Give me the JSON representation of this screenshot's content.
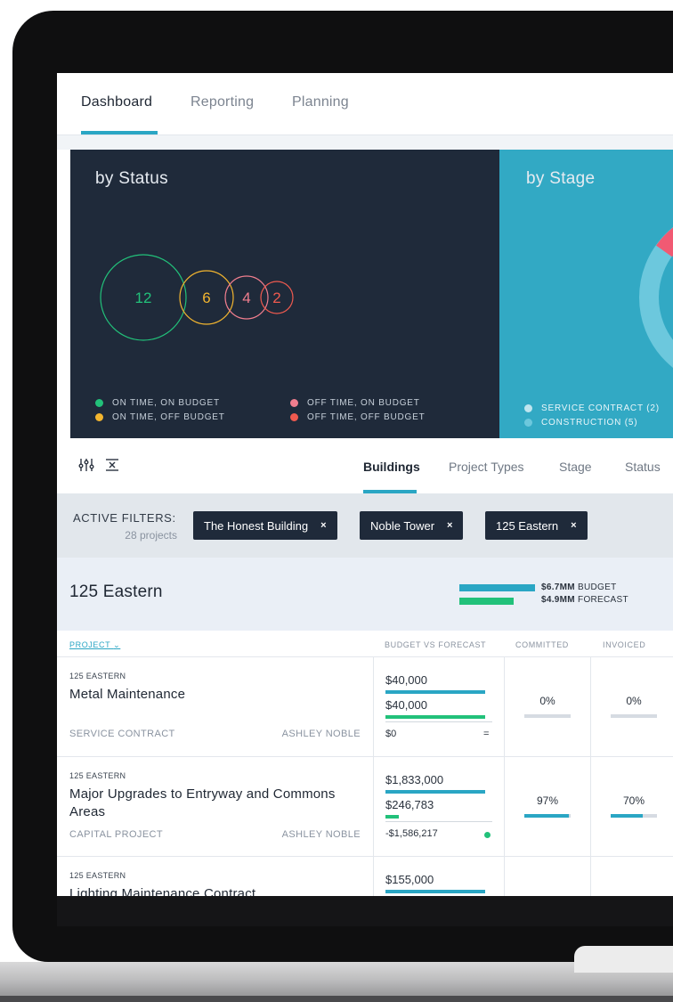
{
  "nav": {
    "tabs": [
      {
        "label": "Dashboard",
        "active": true
      },
      {
        "label": "Reporting",
        "active": false
      },
      {
        "label": "Planning",
        "active": false
      }
    ]
  },
  "charts": {
    "status": {
      "title": "by Status",
      "bubbles": [
        {
          "value": "12",
          "color": "#22c17a"
        },
        {
          "value": "6",
          "color": "#f2b52f"
        },
        {
          "value": "4",
          "color": "#f07e8e"
        },
        {
          "value": "2",
          "color": "#ef5a4f"
        }
      ],
      "legend": [
        {
          "label": "ON TIME, ON BUDGET",
          "color": "#22c17a"
        },
        {
          "label": "ON TIME, OFF BUDGET",
          "color": "#f2b52f"
        },
        {
          "label": "OFF TIME, ON BUDGET",
          "color": "#f07e8e"
        },
        {
          "label": "OFF TIME, OFF BUDGET",
          "color": "#ef5a4f"
        }
      ]
    },
    "stage": {
      "title": "by Stage",
      "legend": [
        {
          "label": "SERVICE CONTRACT (2)",
          "color": "#bfe5ef"
        },
        {
          "label": "CONSTRUCTION (5)",
          "color": "#6cc8dd"
        }
      ],
      "donut_colors": {
        "highlight": "#f15a73",
        "ring": "#6cc8dd"
      }
    }
  },
  "toolbar": {
    "icons": [
      "sliders-icon",
      "collapse-icon"
    ],
    "tabs": [
      {
        "label": "Buildings",
        "active": true
      },
      {
        "label": "Project Types",
        "active": false
      },
      {
        "label": "Stage",
        "active": false
      },
      {
        "label": "Status",
        "active": false
      }
    ]
  },
  "filters": {
    "label": "ACTIVE FILTERS:",
    "count": "28 projects",
    "chips": [
      {
        "label": "The Honest Building",
        "remove": "×"
      },
      {
        "label": "Noble Tower",
        "remove": "×"
      },
      {
        "label": "125 Eastern",
        "remove": "×"
      }
    ]
  },
  "group": {
    "title": "125 Eastern",
    "budget_value": "$6.7MM",
    "budget_label": "BUDGET",
    "forecast_value": "$4.9MM",
    "forecast_label": "FORECAST",
    "budget_color": "#2aa6c4",
    "forecast_color": "#22c17a"
  },
  "table": {
    "headers": {
      "project": "PROJECT",
      "bvf": "BUDGET VS FORECAST",
      "committed": "COMMITTED",
      "invoiced": "INVOICED"
    },
    "rows": [
      {
        "building": "125 EASTERN",
        "name": "Metal Maintenance",
        "type": "SERVICE CONTRACT",
        "owner": "ASHLEY NOBLE",
        "budget": "$40,000",
        "forecast": "$40,000",
        "variance": "$0",
        "variance_mark": "=",
        "budget_ratio": 1.0,
        "forecast_ratio": 1.0,
        "committed": "0%",
        "committed_ratio": 0,
        "invoiced": "0%",
        "invoiced_ratio": 0
      },
      {
        "building": "125 EASTERN",
        "name": "Major Upgrades to Entryway and Commons Areas",
        "type": "CAPITAL PROJECT",
        "owner": "ASHLEY NOBLE",
        "budget": "$1,833,000",
        "forecast": "$246,783",
        "variance": "-$1,586,217",
        "variance_mark": "",
        "budget_ratio": 1.0,
        "forecast_ratio": 0.13,
        "committed": "97%",
        "committed_ratio": 0.97,
        "invoiced": "70%",
        "invoiced_ratio": 0.7
      },
      {
        "building": "125 EASTERN",
        "name": "Lighting Maintenance Contract",
        "budget": "$155,000",
        "budget_ratio": 1.0
      }
    ]
  }
}
